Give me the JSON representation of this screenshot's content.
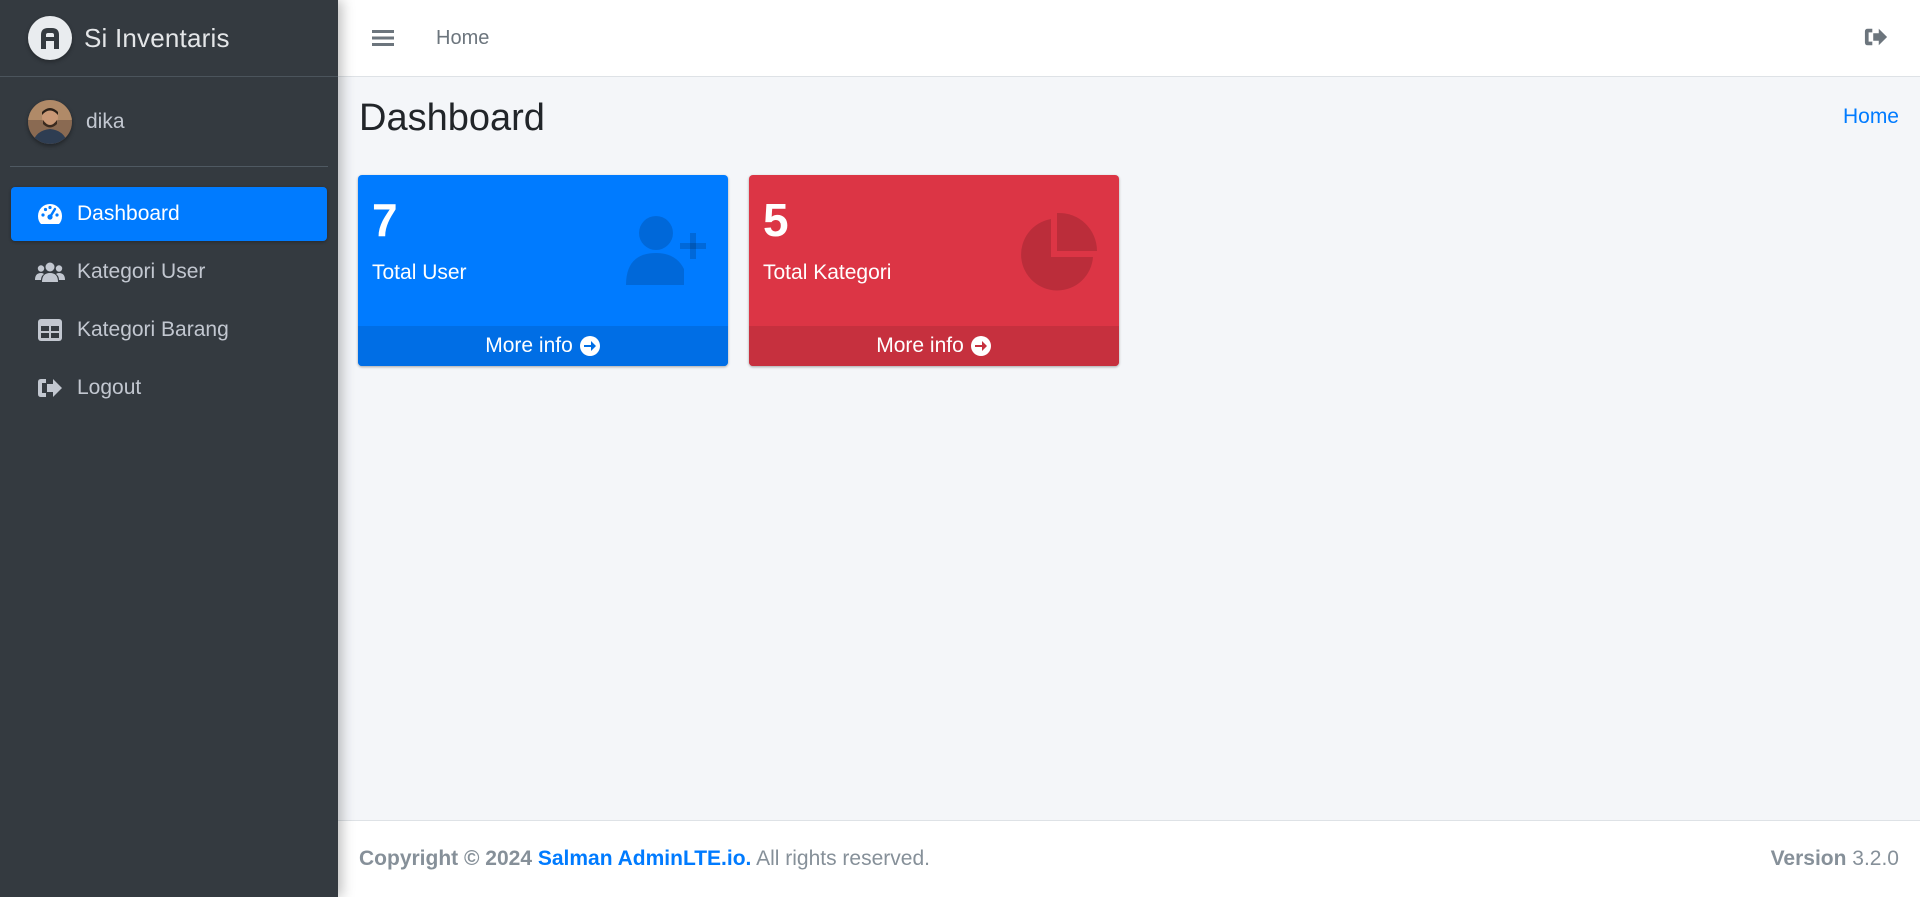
{
  "brand": {
    "name": "Si Inventaris",
    "logo_icon": "adminlte-logo-icon"
  },
  "user": {
    "name": "dika",
    "avatar": "user-avatar"
  },
  "sidebar": {
    "items": [
      {
        "label": "Dashboard",
        "icon": "tachometer-icon",
        "active": true
      },
      {
        "label": "Kategori User",
        "icon": "users-icon",
        "active": false
      },
      {
        "label": "Kategori Barang",
        "icon": "table-icon",
        "active": false
      },
      {
        "label": "Logout",
        "icon": "sign-out-icon",
        "active": false
      }
    ]
  },
  "navbar": {
    "home_label": "Home",
    "menu_icon": "bars-icon",
    "logout_icon": "sign-out-icon"
  },
  "page": {
    "title": "Dashboard",
    "breadcrumb": "Home"
  },
  "cards": [
    {
      "number": "7",
      "label": "Total User",
      "footer": "More info",
      "icon": "user-plus-icon",
      "color": "#007bff"
    },
    {
      "number": "5",
      "label": "Total Kategori",
      "footer": "More info",
      "icon": "pie-chart-icon",
      "color": "#dc3545"
    }
  ],
  "footer": {
    "copyright": "Copyright © 2024",
    "link": "Salman AdminLTE.io.",
    "rights": "All rights reserved.",
    "version_label": "Version",
    "version_value": "3.2.0"
  }
}
